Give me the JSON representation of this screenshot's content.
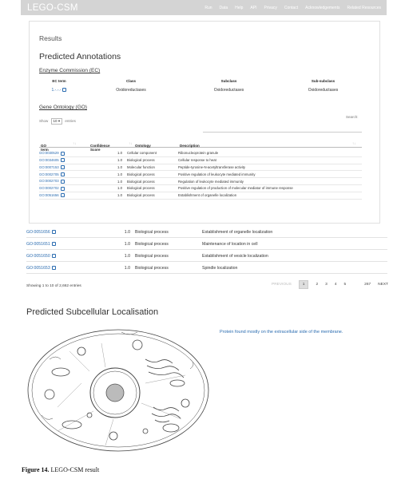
{
  "navbar": {
    "brand": "LEGO-CSM",
    "links": [
      "Run",
      "Data",
      "Help",
      "API",
      "Privacy",
      "Contact",
      "Acknowledgements",
      "Related Resources"
    ]
  },
  "results": {
    "title": "Results",
    "section_title": "Predicted Annotations",
    "ec": {
      "heading": "Enzyme Commission (EC)",
      "columns": [
        "EC term",
        "Class",
        "Subclass",
        "Sub-subclass"
      ],
      "row": {
        "term": "1.-.-.-",
        "class": "Oxidoreductases",
        "subclass": "Oxidoreductases",
        "subsubclass": "Oxidoreductases"
      }
    },
    "go": {
      "heading": "Gene Ontology (GO)",
      "show_label": "Show",
      "show_value": "10",
      "entries_label": "entries",
      "search_label": "Search:",
      "columns": [
        "GO term",
        "Confidence Score",
        "Ontology",
        "Description"
      ],
      "rows": [
        {
          "id": "GO:0030529",
          "score": "1.0",
          "ontology": "Cellular component",
          "desc": "Ribonucleoprotein granule"
        },
        {
          "id": "GO:0034605",
          "score": "1.0",
          "ontology": "Biological process",
          "desc": "Cellular response to heat"
        },
        {
          "id": "GO:0007153",
          "score": "1.0",
          "ontology": "Molecular function",
          "desc": "Peptide-tyrosine-N-acetyltransferase activity"
        },
        {
          "id": "GO:0002705",
          "score": "1.0",
          "ontology": "Biological process",
          "desc": "Positive regulation of leukocyte mediated immunity"
        },
        {
          "id": "GO:0002703",
          "score": "1.0",
          "ontology": "Biological process",
          "desc": "Regulation of leukocyte mediated immunity"
        },
        {
          "id": "GO:0002702",
          "score": "1.0",
          "ontology": "Biological process",
          "desc": "Positive regulation of production of molecular mediator of immune response"
        },
        {
          "id": "GO:0051656",
          "score": "1.0",
          "ontology": "Biological process",
          "desc": "Establishment of organelle localization"
        }
      ],
      "outer_rows": [
        {
          "id": "GO:0051656",
          "score": "1.0",
          "ontology": "Biological process",
          "desc": "Establishment of organelle localization"
        },
        {
          "id": "GO:0051651",
          "score": "1.0",
          "ontology": "Biological process",
          "desc": "Maintenance of location in cell"
        },
        {
          "id": "GO:0051650",
          "score": "1.0",
          "ontology": "Biological process",
          "desc": "Establishment of vesicle localization"
        },
        {
          "id": "GO:0051653",
          "score": "1.0",
          "ontology": "Biological process",
          "desc": "Spindle localization"
        }
      ],
      "showing": "Showing 1 to 10 of 2,662 entries",
      "pagination": {
        "previous": "PREVIOUS",
        "current": "1",
        "pages": [
          "2",
          "3",
          "4",
          "5"
        ],
        "last": "267",
        "next": "NEXT"
      }
    }
  },
  "localisation": {
    "title": "Predicted Subcellular Localisation",
    "text": "Protein found mostly on the extracellular side of the membrane."
  },
  "caption": {
    "label": "Figure 14.",
    "text": " LEGO-CSM result"
  }
}
